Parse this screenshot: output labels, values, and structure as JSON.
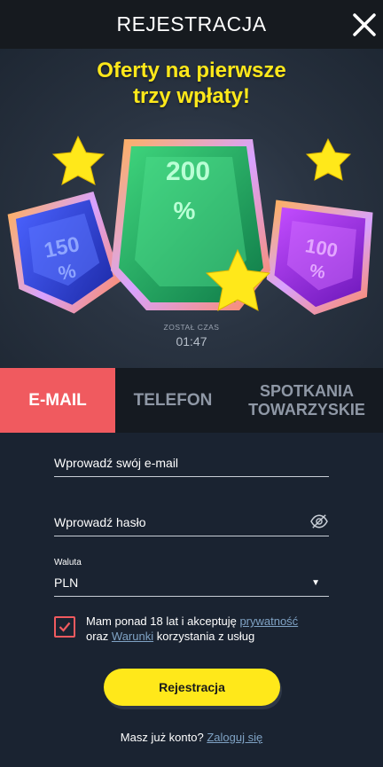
{
  "header": {
    "title": "REJESTRACJA"
  },
  "promo": {
    "title_line1": "Oferty na pierwsze",
    "title_line2": "trzy wpłaty!",
    "gems": {
      "left": {
        "number": "150",
        "unit": "%",
        "color": "#2f41d6"
      },
      "center": {
        "number": "200",
        "unit": "%",
        "color": "#1fa35b"
      },
      "right": {
        "number": "100",
        "unit": "%",
        "color": "#9a2ee0"
      }
    },
    "timer_label": "ZOSTAŁ CZAS",
    "timer_value": "01:47",
    "accent_color": "#ffe81a"
  },
  "tabs": [
    {
      "label": "E-MAIL",
      "active": true
    },
    {
      "label": "TELEFON",
      "active": false
    },
    {
      "label_line1": "SPOTKANIA",
      "label_line2": "TOWARZYSKIE",
      "active": false
    }
  ],
  "form": {
    "email_placeholder": "Wprowadź swój e-mail",
    "password_placeholder": "Wprowadź hasło",
    "currency_caption": "Waluta",
    "currency_value": "PLN",
    "checkbox_checked": true,
    "consent": {
      "part1": "Mam ponad 18 lat i akceptuję ",
      "link1": "prywatność",
      "part2": "oraz ",
      "link2": "Warunki",
      "part3": " korzystania z usług"
    },
    "submit_label": "Rejestracja",
    "login_prompt": "Masz już konto? ",
    "login_link": "Zaloguj się"
  },
  "colors": {
    "tab_active": "#f05a5f",
    "button": "#ffe81a",
    "link": "#7fa2c4"
  }
}
